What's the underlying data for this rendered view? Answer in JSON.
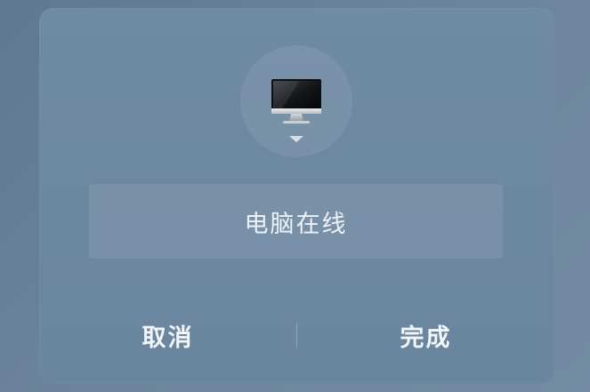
{
  "dialog": {
    "device_icon": "desktop-monitor-icon",
    "status_label": "电脑在线",
    "cancel_label": "取消",
    "done_label": "完成"
  }
}
